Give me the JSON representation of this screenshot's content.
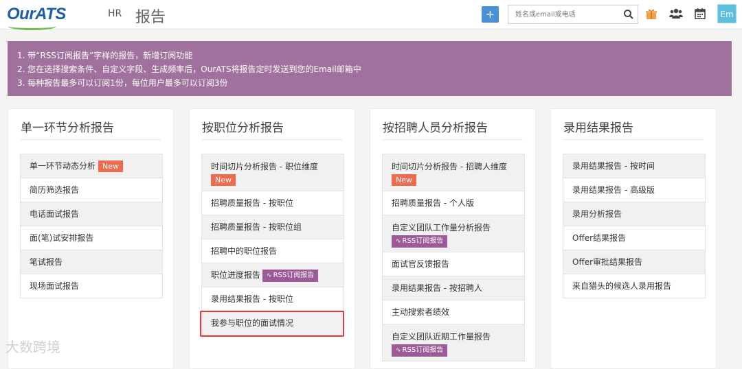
{
  "header": {
    "logo": "OurATS",
    "nav_hr": "HR",
    "title": "报告",
    "add_label": "+",
    "search_placeholder": "姓名或email或电话",
    "avatar": "Em"
  },
  "notice": {
    "lines": [
      "1. 带“RSS订阅报告”字样的报告，新增订阅功能",
      "2. 您在选择搜索条件、自定义字段、生成频率后，OurATS将报告定时发送到您的Email邮箱中",
      "3. 每种报告最多可以订阅1份，每位用户最多可以订阅3份"
    ]
  },
  "badges": {
    "new": "New",
    "rss": "RSS订阅报告"
  },
  "panels": [
    {
      "title": "单一环节分析报告",
      "items": [
        {
          "label": "单一环节动态分析",
          "badge": "new"
        },
        {
          "label": "简历筛选报告"
        },
        {
          "label": "电话面试报告"
        },
        {
          "label": "面(笔)试安排报告"
        },
        {
          "label": "笔试报告"
        },
        {
          "label": "现场面试报告"
        }
      ]
    },
    {
      "title": "按职位分析报告",
      "items": [
        {
          "label": "时间切片分析报告 - 职位维度",
          "badge": "new",
          "tall": true
        },
        {
          "label": "招聘质量报告 - 按职位"
        },
        {
          "label": "招聘质量报告 - 按职位组"
        },
        {
          "label": "招聘中的职位报告"
        },
        {
          "label": "职位进度报告",
          "badge": "rss"
        },
        {
          "label": "录用结果报告 - 按职位"
        },
        {
          "label": "我参与职位的面试情况",
          "highlight": true
        }
      ]
    },
    {
      "title": "按招聘人员分析报告",
      "items": [
        {
          "label": "时间切片分析报告 - 招聘人维度",
          "badge": "new",
          "tall": true
        },
        {
          "label": "招聘质量报告 - 个人版"
        },
        {
          "label": "自定义团队工作量分析报告",
          "badge": "rss",
          "tall": true
        },
        {
          "label": "面试官反馈报告"
        },
        {
          "label": "录用结果报告 - 按招聘人"
        },
        {
          "label": "主动搜索者绩效"
        },
        {
          "label": "自定义团队近期工作量报告",
          "badge": "rss",
          "tall": true
        }
      ]
    },
    {
      "title": "录用结果报告",
      "items": [
        {
          "label": "录用结果报告 - 按时间"
        },
        {
          "label": "录用结果报告 - 高级版"
        },
        {
          "label": "录用分析报告"
        },
        {
          "label": "Offer结果报告"
        },
        {
          "label": "Offer审批结果报告"
        },
        {
          "label": "来自猎头的候选人录用报告"
        }
      ]
    }
  ],
  "watermark": "大数跨境",
  "colors": {
    "accent": "#4a90d9",
    "notice": "#a1719d",
    "new_badge": "#f06a4e",
    "rss_badge": "#9c5b97",
    "highlight": "#e03b3b"
  }
}
